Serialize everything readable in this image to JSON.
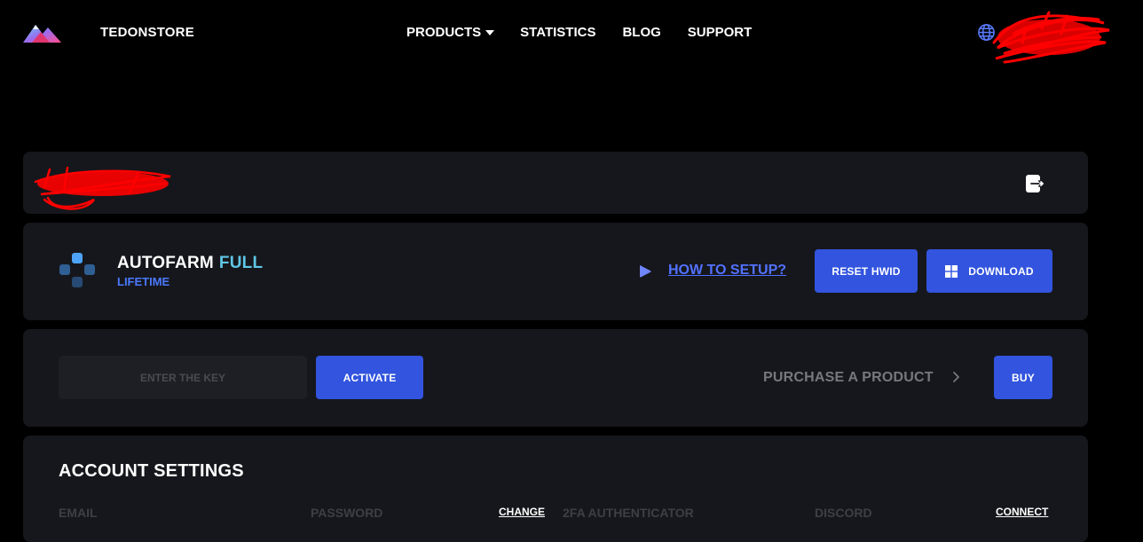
{
  "header": {
    "brand": "TEDONSTORE",
    "nav": {
      "products": "PRODUCTS",
      "statistics": "STATISTICS",
      "blog": "BLOG",
      "support": "SUPPORT"
    },
    "language_icon": "globe-icon"
  },
  "product": {
    "name": "AUTOFARM",
    "variant": "FULL",
    "license": "LIFETIME",
    "howto_label": "HOW TO SETUP?",
    "reset_label": "RESET HWID",
    "download_label": "DOWNLOAD"
  },
  "activation": {
    "key_placeholder": "ENTER THE KEY",
    "activate_label": "ACTIVATE",
    "purchase_label": "PURCHASE A PRODUCT",
    "buy_label": "BUY"
  },
  "settings": {
    "title": "ACCOUNT SETTINGS",
    "email_label": "EMAIL",
    "password_label": "PASSWORD",
    "password_action": "CHANGE",
    "twofa_label": "2FA AUTHENTICATOR",
    "discord_label": "DISCORD",
    "discord_action": "CONNECT"
  },
  "colors": {
    "background": "#000000",
    "panel": "#16171c",
    "primary_button": "#3254de",
    "link": "#5271ff",
    "accent_cyan": "#5fc6e5",
    "redaction": "#ff0000"
  }
}
